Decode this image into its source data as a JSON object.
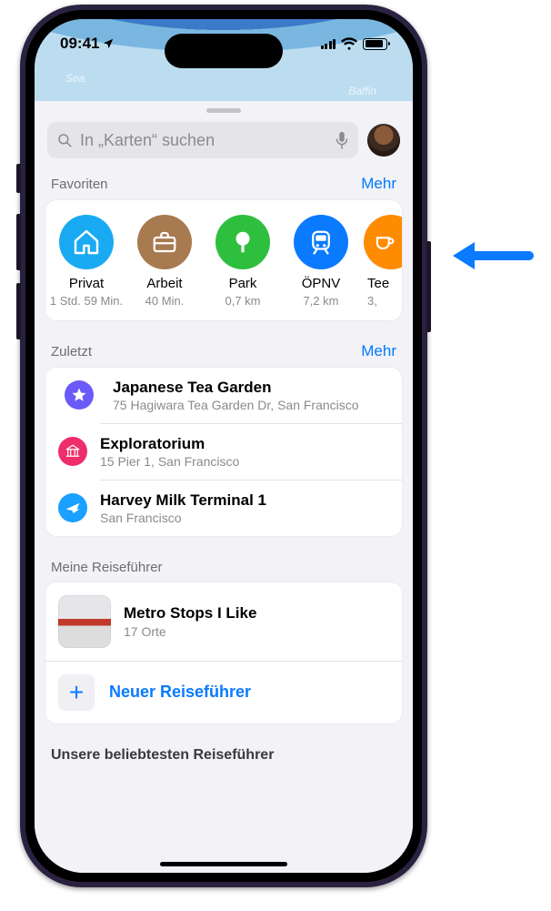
{
  "status": {
    "time": "09:41"
  },
  "search": {
    "placeholder": "In „Karten“ suchen"
  },
  "sections": {
    "favorites": {
      "title": "Favoriten",
      "more": "Mehr"
    },
    "recents": {
      "title": "Zuletzt",
      "more": "Mehr"
    },
    "guides": {
      "title": "Meine Reiseführer"
    },
    "popular": {
      "title": "Unsere beliebtesten Reiseführer"
    }
  },
  "favorites": [
    {
      "label": "Privat",
      "meta": "1 Std. 59 Min.",
      "icon": "home",
      "color": "#1aaaf3"
    },
    {
      "label": "Arbeit",
      "meta": "40 Min.",
      "icon": "briefcase",
      "color": "#a87a4f"
    },
    {
      "label": "Park",
      "meta": "0,7 km",
      "icon": "tree",
      "color": "#2fbf3e"
    },
    {
      "label": "ÖPNV",
      "meta": "7,2 km",
      "icon": "transit",
      "color": "#0a7aff"
    },
    {
      "label": "Tee",
      "meta": "3,",
      "icon": "cup",
      "color": "#ff8c00"
    }
  ],
  "recents": [
    {
      "title": "Japanese Tea Garden",
      "subtitle": "75 Hagiwara Tea Garden Dr, San Francisco",
      "icon": "star",
      "color": "#6a5af9"
    },
    {
      "title": "Exploratorium",
      "subtitle": "15 Pier 1, San Francisco",
      "icon": "museum",
      "color": "#ef2d6b"
    },
    {
      "title": "Harvey Milk Terminal 1",
      "subtitle": "San Francisco",
      "icon": "plane",
      "color": "#1aa0ff"
    }
  ],
  "guides": [
    {
      "title": "Metro Stops I Like",
      "subtitle": "17 Orte"
    }
  ],
  "new_guide_label": "Neuer Reiseführer",
  "map_labels": {
    "sea": "Sea",
    "baffin": "Baffin"
  }
}
